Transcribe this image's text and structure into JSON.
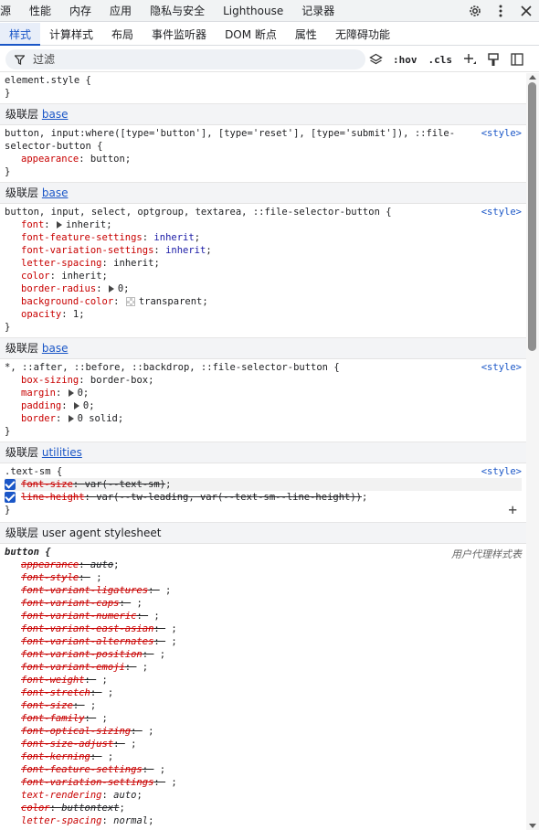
{
  "top_tabs": [
    "源",
    "性能",
    "内存",
    "应用",
    "隐私与安全",
    "Lighthouse",
    "记录器"
  ],
  "top_icons": [
    "gear-icon",
    "more-vert-icon",
    "close-icon"
  ],
  "sub_tabs": [
    "样式",
    "计算样式",
    "布局",
    "事件监听器",
    "DOM 断点",
    "属性",
    "无障碍功能"
  ],
  "filter": {
    "placeholder": "过滤",
    "hov": ":hov",
    "cls": ".cls"
  },
  "layer_label": "级联层",
  "element_style": {
    "selector": "element.style {",
    "close": "}"
  },
  "sections": [
    {
      "layer": "base",
      "selector_lines": [
        "button, input:where([type='button'], [type='reset'], [type='submit']), ::file-",
        "selector-button {"
      ],
      "source": "<style>",
      "props": [
        {
          "name": "appearance",
          "value": "button"
        }
      ]
    },
    {
      "layer": "base",
      "selector_lines": [
        "button, input, select, optgroup, textarea, ::file-selector-button {"
      ],
      "source": "<style>",
      "props": [
        {
          "name": "font",
          "value": "inherit",
          "expand": true
        },
        {
          "name": "font-feature-settings",
          "value": "inherit",
          "kw": true
        },
        {
          "name": "font-variation-settings",
          "value": "inherit",
          "kw": true
        },
        {
          "name": "letter-spacing",
          "value": "inherit"
        },
        {
          "name": "color",
          "value": "inherit"
        },
        {
          "name": "border-radius",
          "value": "0",
          "expand": true
        },
        {
          "name": "background-color",
          "value": "transparent",
          "swatch": true
        },
        {
          "name": "opacity",
          "value": "1"
        }
      ]
    },
    {
      "layer": "base",
      "selector_lines": [
        "*, ::after, ::before, ::backdrop, ::file-selector-button {"
      ],
      "source": "<style>",
      "props": [
        {
          "name": "box-sizing",
          "value": "border-box"
        },
        {
          "name": "margin",
          "value": "0",
          "expand": true
        },
        {
          "name": "padding",
          "value": "0",
          "expand": true
        },
        {
          "name": "border",
          "value": "0 solid",
          "expand": true
        }
      ]
    },
    {
      "layer": "utilities",
      "selector_lines": [
        ".text-sm {"
      ],
      "source": "<style>",
      "props": [
        {
          "name": "font-size",
          "value": "var(--text-sm)",
          "checked": true,
          "strike": true
        },
        {
          "name": "line-height",
          "value": "var(--tw-leading, var(--text-sm--line-height))",
          "checked": true,
          "strike": true
        }
      ]
    }
  ],
  "ua": {
    "layer": "user agent stylesheet",
    "selector": "button {",
    "source": "用户代理样式表",
    "props": [
      {
        "name": "appearance",
        "value": "auto"
      },
      {
        "name": "font-style",
        "value": ""
      },
      {
        "name": "font-variant-ligatures",
        "value": ""
      },
      {
        "name": "font-variant-caps",
        "value": ""
      },
      {
        "name": "font-variant-numeric",
        "value": ""
      },
      {
        "name": "font-variant-east-asian",
        "value": ""
      },
      {
        "name": "font-variant-alternates",
        "value": ""
      },
      {
        "name": "font-variant-position",
        "value": ""
      },
      {
        "name": "font-variant-emoji",
        "value": ""
      },
      {
        "name": "font-weight",
        "value": ""
      },
      {
        "name": "font-stretch",
        "value": ""
      },
      {
        "name": "font-size",
        "value": ""
      },
      {
        "name": "font-family",
        "value": ""
      },
      {
        "name": "font-optical-sizing",
        "value": ""
      },
      {
        "name": "font-size-adjust",
        "value": ""
      },
      {
        "name": "font-kerning",
        "value": ""
      },
      {
        "name": "font-feature-settings",
        "value": ""
      },
      {
        "name": "font-variation-settings",
        "value": ""
      },
      {
        "name": "text-rendering",
        "value": "auto",
        "active": true
      },
      {
        "name": "color",
        "value": "buttontext"
      },
      {
        "name": "letter-spacing",
        "value": "normal",
        "active": true
      }
    ]
  },
  "colors": {
    "accent": "#1a56c7",
    "prop_name": "#c80000",
    "layer_bg": "#f3f4f6"
  }
}
